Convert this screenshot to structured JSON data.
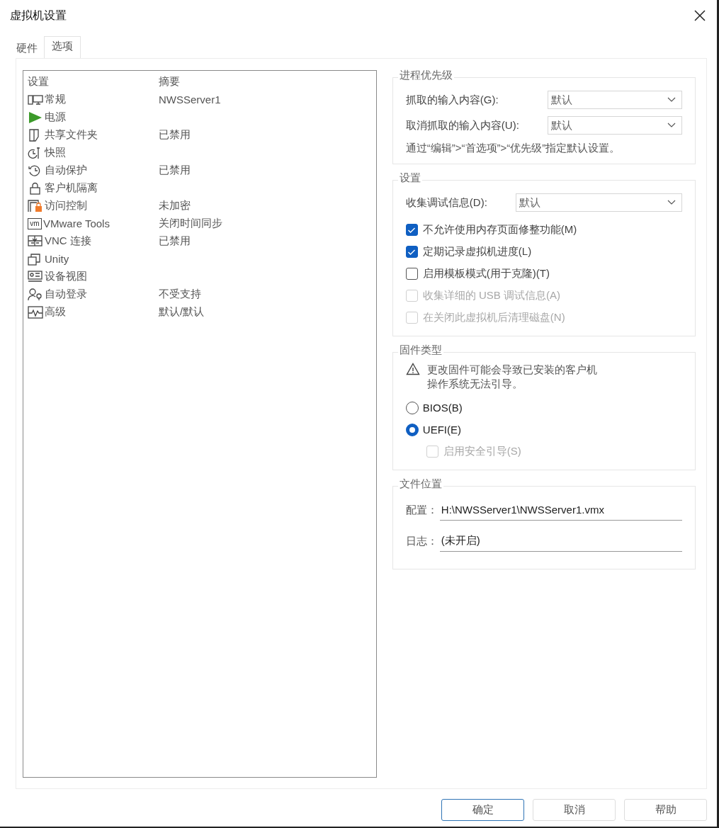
{
  "window": {
    "title": "虚拟机设置"
  },
  "tabs": [
    {
      "label": "硬件",
      "selected": false
    },
    {
      "label": "选项",
      "selected": true
    }
  ],
  "settings_list": {
    "columns": [
      "设置",
      "摘要"
    ],
    "rows": [
      {
        "name": "常规",
        "summary": "NWSServer1"
      },
      {
        "name": "电源"
      },
      {
        "name": "共享文件夹",
        "summary": "已禁用"
      },
      {
        "name": "快照"
      },
      {
        "name": "自动保护",
        "summary": "已禁用"
      },
      {
        "name": "客户机隔离"
      },
      {
        "name": "访问控制",
        "summary": "未加密"
      },
      {
        "name": "VMware Tools",
        "summary": "关闭时间同步",
        "icon_text": "vm"
      },
      {
        "name": "VNC 连接",
        "summary": "已禁用"
      },
      {
        "name": "Unity"
      },
      {
        "name": "设备视图"
      },
      {
        "name": "自动登录",
        "summary": "不受支持"
      },
      {
        "name": "高级",
        "summary": "默认/默认"
      }
    ]
  },
  "priority": {
    "title": "进程优先级",
    "fields": [
      {
        "label": "抓取的输入内容(G):",
        "value": "默认"
      },
      {
        "label": "取消抓取的输入内容(U):",
        "value": "默认"
      }
    ],
    "note": "通过“编辑”>“首选项”>“优先级”指定默认设置。"
  },
  "settings": {
    "title": "设置",
    "fields": [
      {
        "label": "收集调试信息(D):",
        "value": "默认"
      }
    ],
    "checkboxes": [
      {
        "label": "不允许使用内存页面修整功能(M)",
        "checked": true,
        "disabled": false
      },
      {
        "label": "定期记录虚拟机进度(L)",
        "checked": true,
        "disabled": false
      },
      {
        "label": "启用模板模式(用于克隆)(T)",
        "checked": false,
        "disabled": false
      },
      {
        "label": "收集详细的 USB 调试信息(A)",
        "checked": false,
        "disabled": true
      },
      {
        "label": "在关闭此虚拟机后清理磁盘(N)",
        "checked": false,
        "disabled": true
      }
    ]
  },
  "firmware": {
    "title": "固件类型",
    "warning": "更改固件可能会导致已安装的客户机操作系统无法引导。",
    "options": [
      {
        "label": "BIOS(B)",
        "selected": false
      },
      {
        "label": "UEFI(E)",
        "selected": true
      }
    ],
    "secure_boot": {
      "label": "启用安全引导(S)",
      "checked": false,
      "disabled": true
    }
  },
  "files": {
    "title": "文件位置",
    "fields": [
      {
        "label": "配置：",
        "value": "H:\\NWSServer1\\NWSServer1.vmx"
      },
      {
        "label": "日志：",
        "value": "(未开启)"
      }
    ]
  },
  "buttons": [
    {
      "label": "确定",
      "default": true
    },
    {
      "label": "取消",
      "default": false
    },
    {
      "label": "帮助",
      "default": false
    }
  ]
}
